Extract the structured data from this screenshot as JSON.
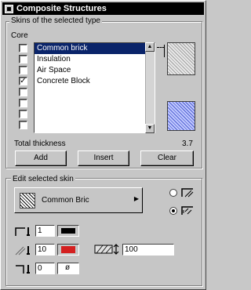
{
  "window": {
    "title": "Composite Structures"
  },
  "skins_group": {
    "label": "Skins of the selected type",
    "column_label": "Core",
    "items": [
      {
        "label": "Common brick",
        "core": false,
        "selected": true
      },
      {
        "label": "Insulation",
        "core": false,
        "selected": false
      },
      {
        "label": "Air Space",
        "core": false,
        "selected": false
      },
      {
        "label": "Concrete Block",
        "core": true,
        "selected": false
      },
      {
        "label": "",
        "core": false,
        "selected": false
      },
      {
        "label": "",
        "core": false,
        "selected": false
      },
      {
        "label": "",
        "core": false,
        "selected": false
      },
      {
        "label": "",
        "core": false,
        "selected": false
      }
    ],
    "total_thickness_label": "Total thickness",
    "total_thickness_value": "3.7",
    "buttons": {
      "add": "Add",
      "insert": "Insert",
      "clear": "Clear"
    }
  },
  "edit_group": {
    "label": "Edit selected skin",
    "fill_name": "Common Bric"
  },
  "fields": {
    "contour_pen": "1",
    "fill_pen": "10",
    "bg_pen": "0",
    "thickness": "100"
  },
  "colors": {
    "accent": "#d42020",
    "selection": "#0a246a"
  }
}
